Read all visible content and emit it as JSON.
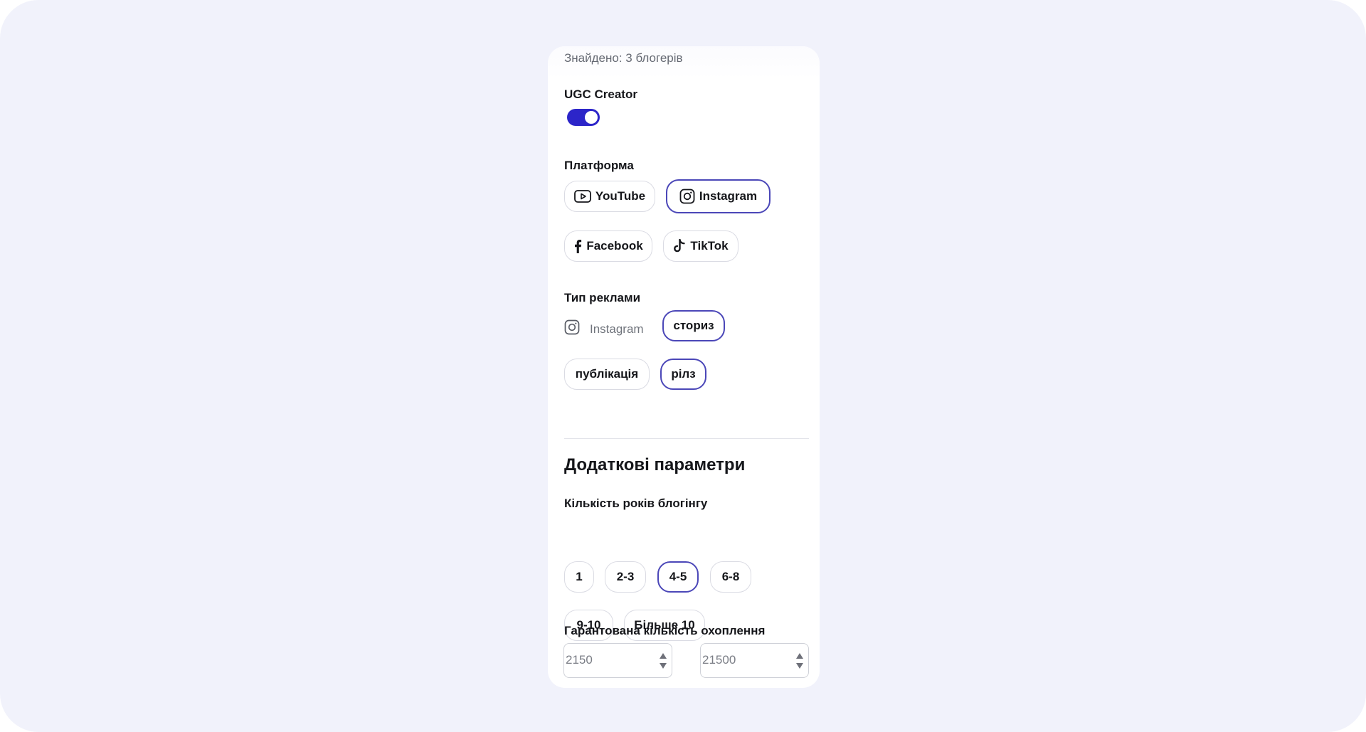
{
  "results": {
    "found_text": "Знайдено: 3 блогерів"
  },
  "ugc": {
    "label": "UGC Creator",
    "enabled": true
  },
  "platform": {
    "label": "Платформа",
    "options": [
      {
        "label": "YouTube",
        "icon": "youtube-icon",
        "selected": false
      },
      {
        "label": "Instagram",
        "icon": "instagram-icon",
        "selected": true
      },
      {
        "label": "Facebook",
        "icon": "facebook-icon",
        "selected": false
      },
      {
        "label": "TikTok",
        "icon": "tiktok-icon",
        "selected": false
      }
    ]
  },
  "ad_type": {
    "label": "Тип реклами",
    "platform_label": "Instagram",
    "platform_icon": "instagram-icon",
    "options": [
      {
        "label": "сториз",
        "selected": true
      },
      {
        "label": "публікація",
        "selected": false
      },
      {
        "label": "рілз",
        "selected": true
      }
    ]
  },
  "extra": {
    "title": "Додаткові параметри",
    "years": {
      "label": "Кількість років блогінгу",
      "options": [
        {
          "label": "1",
          "selected": false
        },
        {
          "label": "2-3",
          "selected": false
        },
        {
          "label": "4-5",
          "selected": true
        },
        {
          "label": "6-8",
          "selected": false
        },
        {
          "label": "9-10",
          "selected": false
        },
        {
          "label": "Більше 10",
          "selected": false
        }
      ]
    },
    "reach": {
      "label": "Гарантована кількість охоплення",
      "min_value": "2150",
      "max_value": "21500"
    }
  },
  "colors": {
    "accent": "#2c25c9",
    "selected_border": "#4b47b8",
    "background": "#f1f2fb"
  }
}
